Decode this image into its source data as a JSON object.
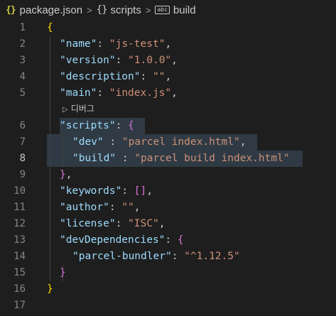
{
  "breadcrumb": {
    "json_icon": "{}",
    "file": "package.json",
    "sep1": ">",
    "scripts_icon": "{}",
    "scripts": "scripts",
    "sep2": ">",
    "field_icon": "abc",
    "build": "build"
  },
  "codelens": {
    "icon": "▷",
    "label": "디버그"
  },
  "lines": [
    {
      "n": "1",
      "tokens": [
        [
          "b1",
          "{"
        ]
      ]
    },
    {
      "n": "2",
      "tokens": [
        [
          "k",
          "\"name\""
        ],
        [
          "p",
          ": "
        ],
        [
          "s",
          "\"js-test\""
        ],
        [
          "p",
          ","
        ]
      ]
    },
    {
      "n": "3",
      "tokens": [
        [
          "k",
          "\"version\""
        ],
        [
          "p",
          ": "
        ],
        [
          "s",
          "\"1.0.0\""
        ],
        [
          "p",
          ","
        ]
      ]
    },
    {
      "n": "4",
      "tokens": [
        [
          "k",
          "\"description\""
        ],
        [
          "p",
          ": "
        ],
        [
          "s",
          "\"\""
        ],
        [
          "p",
          ","
        ]
      ]
    },
    {
      "n": "5",
      "tokens": [
        [
          "k",
          "\"main\""
        ],
        [
          "p",
          ": "
        ],
        [
          "s",
          "\"index.js\""
        ],
        [
          "p",
          ","
        ]
      ]
    },
    {
      "n": "6",
      "tokens": [
        [
          "k",
          "\"scripts\""
        ],
        [
          "p",
          ": "
        ],
        [
          "b2",
          "{"
        ]
      ]
    },
    {
      "n": "7",
      "tokens": [
        [
          "k",
          "\"dev\""
        ],
        [
          "p",
          " : "
        ],
        [
          "s",
          "\"parcel index.html\""
        ],
        [
          "p",
          ","
        ]
      ]
    },
    {
      "n": "8",
      "tokens": [
        [
          "k",
          "\"build\""
        ],
        [
          "p",
          " : "
        ],
        [
          "s",
          "\"parcel build index.html\""
        ]
      ]
    },
    {
      "n": "9",
      "tokens": [
        [
          "b2",
          "}"
        ],
        [
          "p",
          ","
        ]
      ]
    },
    {
      "n": "10",
      "tokens": [
        [
          "k",
          "\"keywords\""
        ],
        [
          "p",
          ": "
        ],
        [
          "b2",
          "[]"
        ],
        [
          "p",
          ","
        ]
      ]
    },
    {
      "n": "11",
      "tokens": [
        [
          "k",
          "\"author\""
        ],
        [
          "p",
          ": "
        ],
        [
          "s",
          "\"\""
        ],
        [
          "p",
          ","
        ]
      ]
    },
    {
      "n": "12",
      "tokens": [
        [
          "k",
          "\"license\""
        ],
        [
          "p",
          ": "
        ],
        [
          "s",
          "\"ISC\""
        ],
        [
          "p",
          ","
        ]
      ]
    },
    {
      "n": "13",
      "tokens": [
        [
          "k",
          "\"devDependencies\""
        ],
        [
          "p",
          ": "
        ],
        [
          "b2",
          "{"
        ]
      ]
    },
    {
      "n": "14",
      "tokens": [
        [
          "k",
          "\"parcel-bundler\""
        ],
        [
          "p",
          ": "
        ],
        [
          "s",
          "\"^1.12.5\""
        ]
      ]
    },
    {
      "n": "15",
      "tokens": [
        [
          "b2",
          "}"
        ]
      ]
    },
    {
      "n": "16",
      "tokens": [
        [
          "b1",
          "}"
        ]
      ]
    },
    {
      "n": "17",
      "tokens": []
    }
  ],
  "active_line": "8",
  "colors": {
    "background": "#1e1e1e",
    "key": "#9cdcfe",
    "string": "#ce9178",
    "bracket_level1": "#ffd700",
    "bracket_level2": "#da70d6",
    "selection_highlight": "#2f3a44"
  }
}
